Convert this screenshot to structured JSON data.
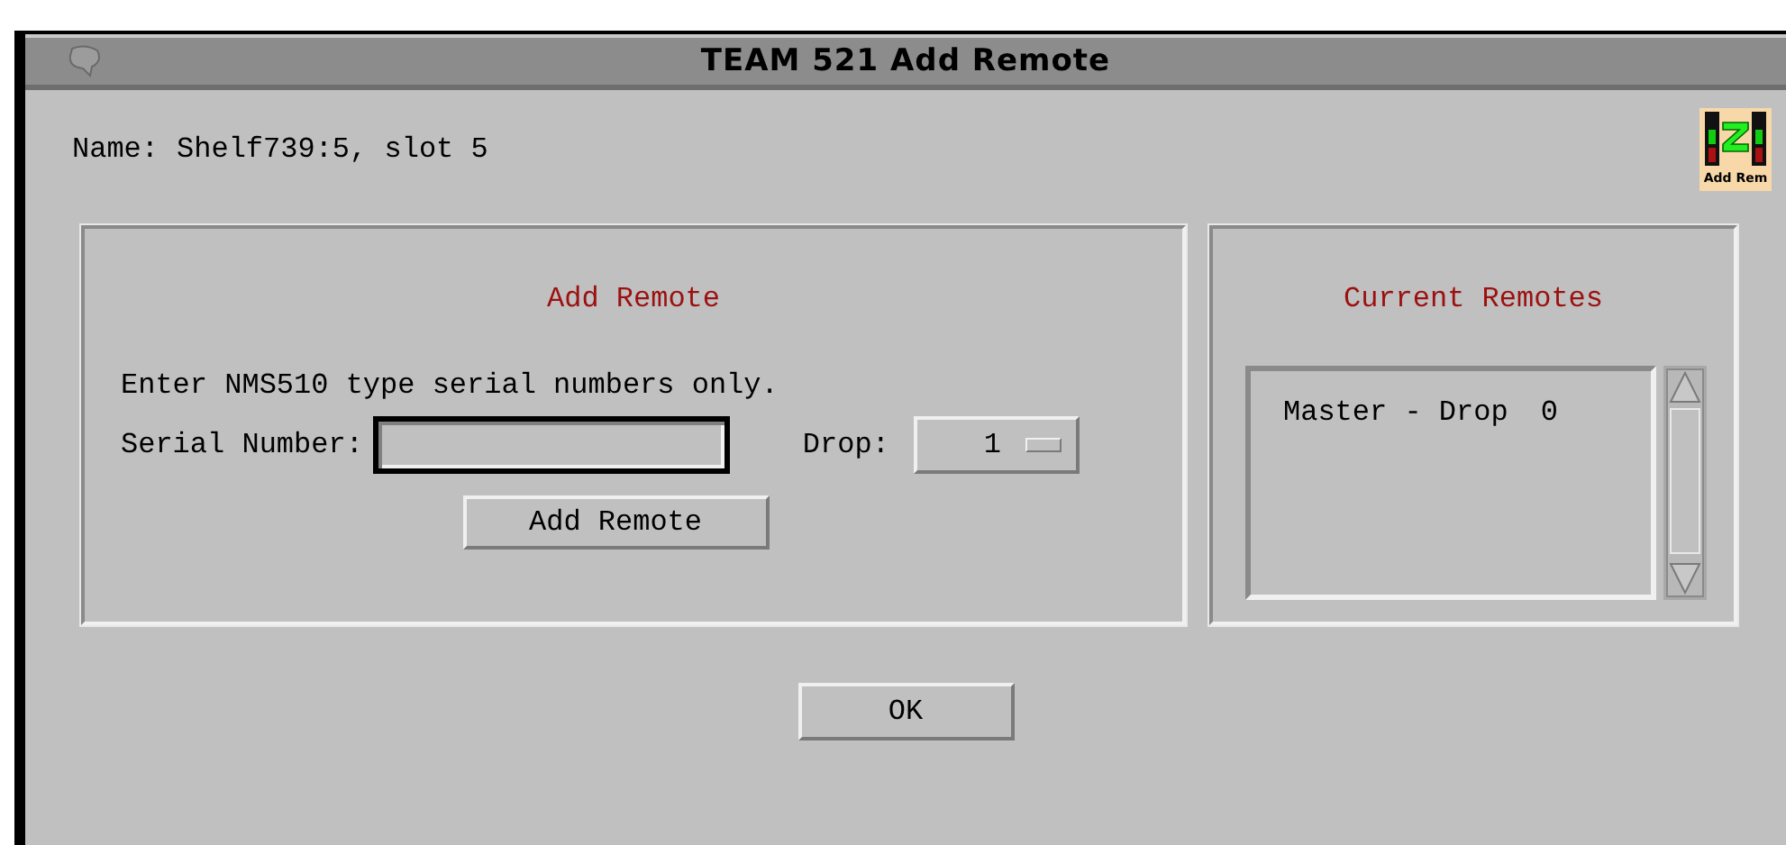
{
  "window": {
    "title": "TEAM 521 Add Remote"
  },
  "name_label": "Name:",
  "name_value": "Shelf739:5, slot 5",
  "app_icon": {
    "label": "Add Rem"
  },
  "add_panel": {
    "title": "Add Remote",
    "hint": "Enter NMS510 type serial numbers only.",
    "serial_label": "Serial Number:",
    "drop_label": "Drop:",
    "drop_value": "1",
    "button": "Add Remote"
  },
  "remotes_panel": {
    "title": "Current Remotes",
    "items": [
      {
        "label": "Master - Drop",
        "drop": "0"
      }
    ]
  },
  "buttons": [
    "OK"
  ]
}
